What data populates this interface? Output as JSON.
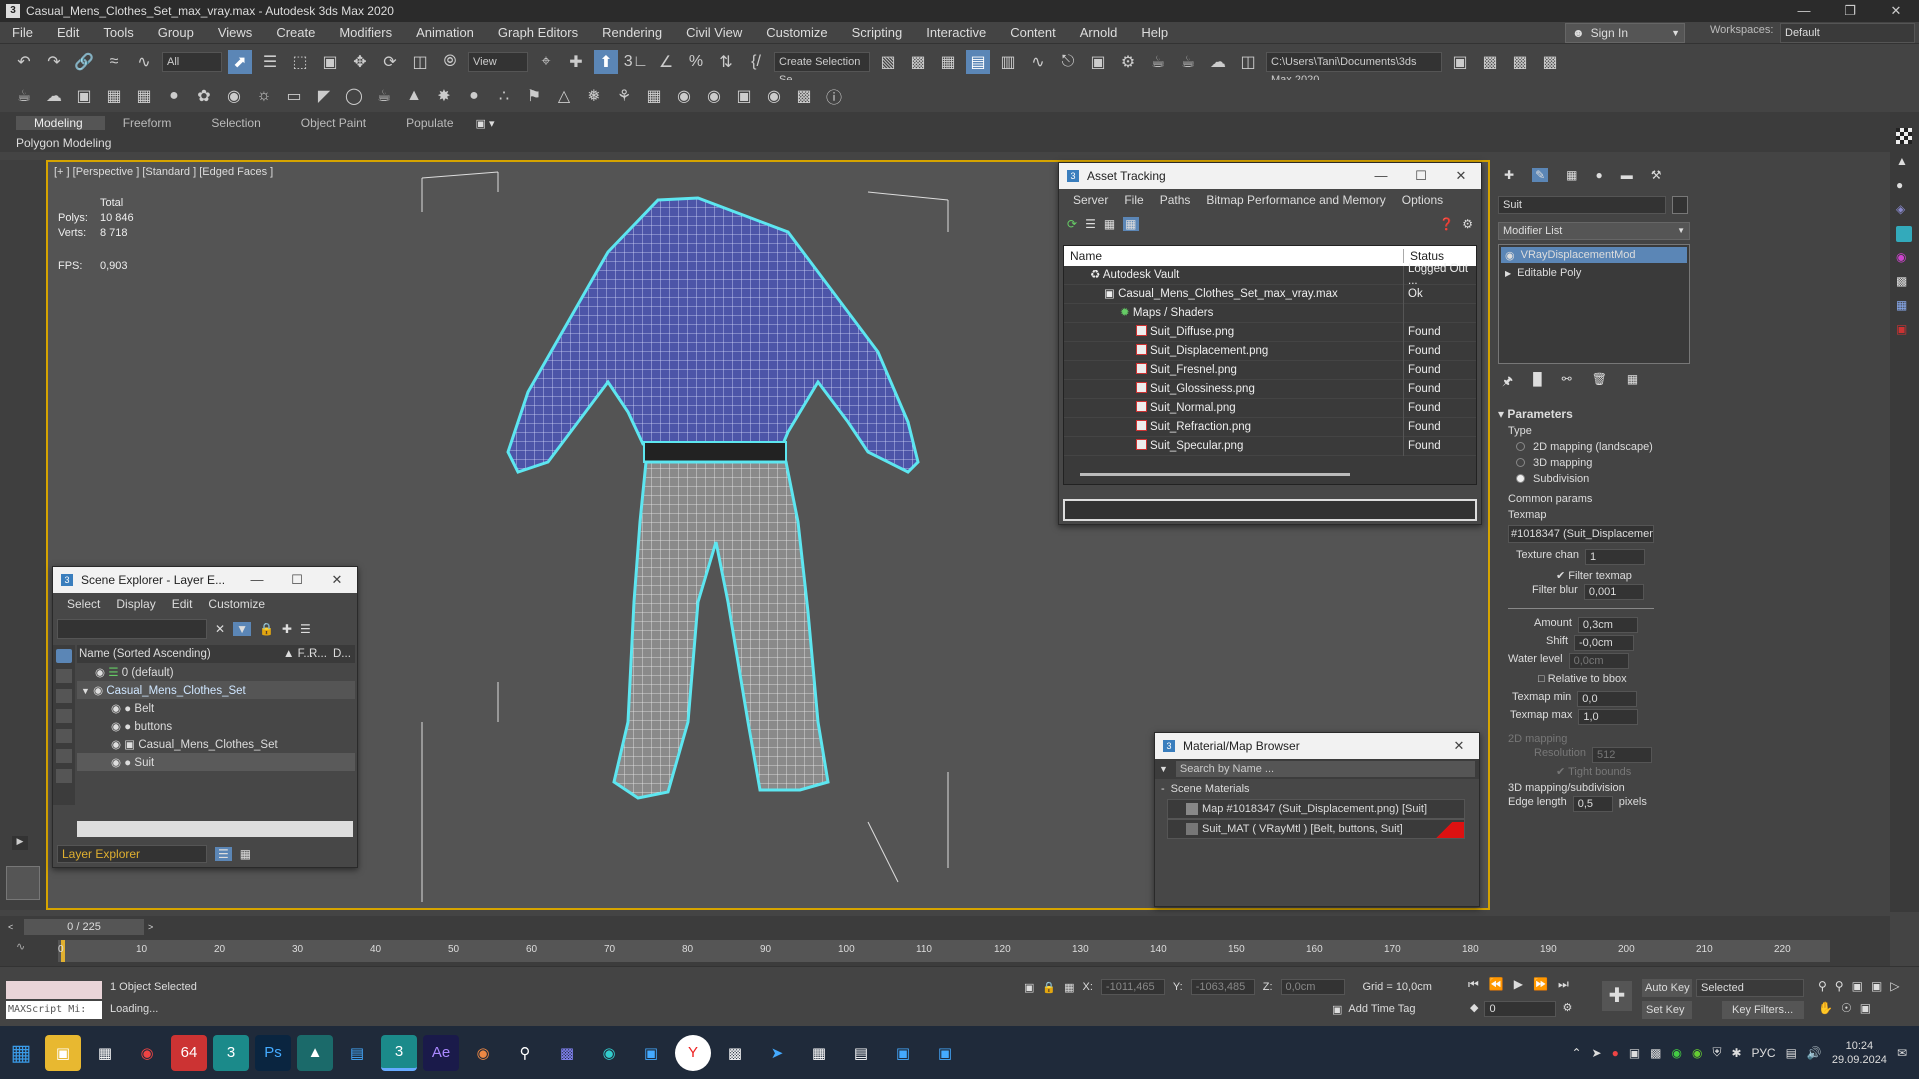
{
  "window": {
    "title": "Casual_Mens_Clothes_Set_max_vray.max - Autodesk 3ds Max 2020",
    "app_icon": "3"
  },
  "menu": [
    "File",
    "Edit",
    "Tools",
    "Group",
    "Views",
    "Create",
    "Modifiers",
    "Animation",
    "Graph Editors",
    "Rendering",
    "Civil View",
    "Customize",
    "Scripting",
    "Interactive",
    "Content",
    "Arnold",
    "Help"
  ],
  "account": {
    "sign_in": "Sign In",
    "workspaces_label": "Workspaces:",
    "workspace": "Default"
  },
  "toolbar": {
    "selection_filter": "All",
    "ref_coord": "View",
    "named_selection": "Create Selection Se",
    "project_path": "C:\\Users\\Tani\\Documents\\3ds Max 2020"
  },
  "ribbon": {
    "tabs": [
      "Modeling",
      "Freeform",
      "Selection",
      "Object Paint",
      "Populate"
    ],
    "sub": "Polygon Modeling"
  },
  "viewport": {
    "label": "[+ ] [Perspective ] [Standard ] [Edged Faces ]",
    "stats": {
      "total_label": "Total",
      "polys_label": "Polys:",
      "polys": "10 846",
      "verts_label": "Verts:",
      "verts": "8 718",
      "fps_label": "FPS:",
      "fps": "0,903"
    }
  },
  "asset_tracking": {
    "title": "Asset Tracking",
    "menu": [
      "Server",
      "File",
      "Paths",
      "Bitmap Performance and Memory",
      "Options"
    ],
    "columns": [
      "Name",
      "Status"
    ],
    "rows": [
      {
        "name": "Autodesk Vault",
        "status": "Logged Out ..."
      },
      {
        "name": "Casual_Mens_Clothes_Set_max_vray.max",
        "status": "Ok"
      },
      {
        "name": "Maps / Shaders",
        "status": ""
      },
      {
        "name": "Suit_Diffuse.png",
        "status": "Found"
      },
      {
        "name": "Suit_Displacement.png",
        "status": "Found"
      },
      {
        "name": "Suit_Fresnel.png",
        "status": "Found"
      },
      {
        "name": "Suit_Glossiness.png",
        "status": "Found"
      },
      {
        "name": "Suit_Normal.png",
        "status": "Found"
      },
      {
        "name": "Suit_Refraction.png",
        "status": "Found"
      },
      {
        "name": "Suit_Specular.png",
        "status": "Found"
      }
    ]
  },
  "scene_explorer": {
    "title": "Scene Explorer - Layer E...",
    "menu": [
      "Select",
      "Display",
      "Edit",
      "Customize"
    ],
    "header": {
      "name": "Name (Sorted Ascending)",
      "c2": "▲ F...",
      "c3": "R...",
      "c4": "D..."
    },
    "rows": [
      {
        "name": "0 (default)"
      },
      {
        "name": "Casual_Mens_Clothes_Set"
      },
      {
        "name": "Belt"
      },
      {
        "name": "buttons"
      },
      {
        "name": "Casual_Mens_Clothes_Set"
      },
      {
        "name": "Suit"
      }
    ],
    "footer": "Layer Explorer"
  },
  "material_browser": {
    "title": "Material/Map Browser",
    "search_placeholder": "Search by Name ...",
    "section": "Scene Materials",
    "items": [
      "Map #1018347 (Suit_Displacement.png)  [Suit]",
      "Suit_MAT  ( VRayMtl )  [Belt, buttons, Suit]"
    ]
  },
  "command_panel": {
    "object_name": "Suit",
    "modifier_list": "Modifier List",
    "stack": [
      "VRayDisplacementMod",
      "Editable Poly"
    ],
    "rollout": "Parameters",
    "type_label": "Type",
    "types": [
      "2D mapping (landscape)",
      "3D mapping",
      "Subdivision"
    ],
    "common_label": "Common params",
    "texmap_label": "Texmap",
    "texmap": "#1018347 (Suit_Displacement",
    "texture_chan_label": "Texture chan",
    "texture_chan": "1",
    "filter_texmap": "Filter texmap",
    "filter_blur_label": "Filter blur",
    "filter_blur": "0,001",
    "amount_label": "Amount",
    "amount": "0,3cm",
    "shift_label": "Shift",
    "shift": "-0,0cm",
    "water_label": "Water level",
    "water": "0,0cm",
    "relative": "Relative to bbox",
    "texmap_min_label": "Texmap min",
    "texmap_min": "0,0",
    "texmap_max_label": "Texmap max",
    "texmap_max": "1,0",
    "mapping2d_label": "2D mapping",
    "resolution_label": "Resolution",
    "resolution": "512",
    "tight": "Tight bounds",
    "subdiv_label": "3D mapping/subdivision",
    "edge_label": "Edge length",
    "edge": "0,5",
    "edge_unit": "pixels"
  },
  "timeline": {
    "frame": "0 / 225",
    "ticks": [
      "0",
      "10",
      "20",
      "30",
      "40",
      "50",
      "60",
      "70",
      "80",
      "90",
      "100",
      "110",
      "120",
      "130",
      "140",
      "150",
      "160",
      "170",
      "180",
      "190",
      "200",
      "210",
      "220"
    ]
  },
  "status": {
    "maxscript": "MAXScript Mi:",
    "selected": "1 Object Selected",
    "loading": "Loading...",
    "x_label": "X:",
    "x": "-1011,465",
    "y_label": "Y:",
    "y": "-1063,485",
    "z_label": "Z:",
    "z": "0,0cm",
    "grid": "Grid = 10,0cm",
    "add_time_tag": "Add Time Tag",
    "auto_key": "Auto Key",
    "set_key": "Set Key",
    "key_mode": "Selected",
    "key_filters": "Key Filters...",
    "frame_field": "0"
  },
  "taskbar": {
    "lang": "РУС",
    "time": "10:24",
    "date": "29.09.2024",
    "apps": [
      "explorer",
      "task-view",
      "chrome",
      "64",
      "3dsmax",
      "photoshop",
      "app",
      "notepad",
      "3dsmax-active",
      "after-effects",
      "g-app",
      "search-app",
      "archive",
      "edge",
      "box",
      "yandex",
      "terminal",
      "telegram",
      "calculator",
      "document",
      "image",
      "screenshot"
    ]
  },
  "colors": {
    "accent": "#5b86b6",
    "viewport_border": "#d6a400",
    "selection_cyan": "#5de6f0",
    "shirt": "#4d55a8"
  }
}
